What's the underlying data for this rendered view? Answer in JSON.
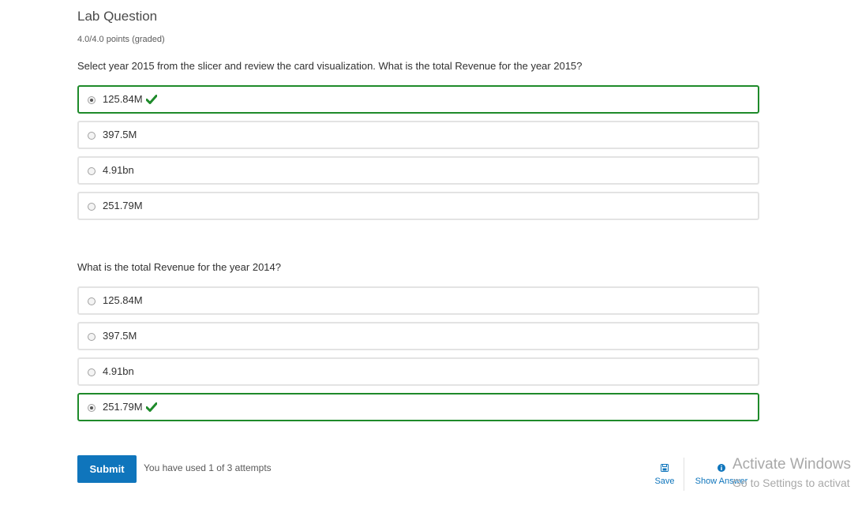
{
  "problem": {
    "title": "Lab Question",
    "points": "4.0/4.0 points (graded)"
  },
  "questions": [
    {
      "prompt": "Select year 2015 from the slicer and review the card visualization. What is the total Revenue for the year 2015?",
      "options": [
        {
          "label": "125.84M",
          "selected": true,
          "correct": true
        },
        {
          "label": "397.5M",
          "selected": false
        },
        {
          "label": "4.91bn",
          "selected": false
        },
        {
          "label": "251.79M",
          "selected": false
        }
      ]
    },
    {
      "prompt": "What is the total Revenue for the year 2014?",
      "options": [
        {
          "label": "125.84M",
          "selected": false
        },
        {
          "label": "397.5M",
          "selected": false
        },
        {
          "label": "4.91bn",
          "selected": false
        },
        {
          "label": "251.79M",
          "selected": true,
          "correct": true
        }
      ]
    }
  ],
  "footer": {
    "submit_label": "Submit",
    "attempts_text": "You have used 1 of 3 attempts",
    "save_label": "Save",
    "show_answer_label": "Show Answer"
  },
  "watermark": {
    "line1": "Activate Windows",
    "line2": "Go to Settings to activat"
  },
  "colors": {
    "correct": "#1e8a2a",
    "accent": "#0f75bc"
  }
}
